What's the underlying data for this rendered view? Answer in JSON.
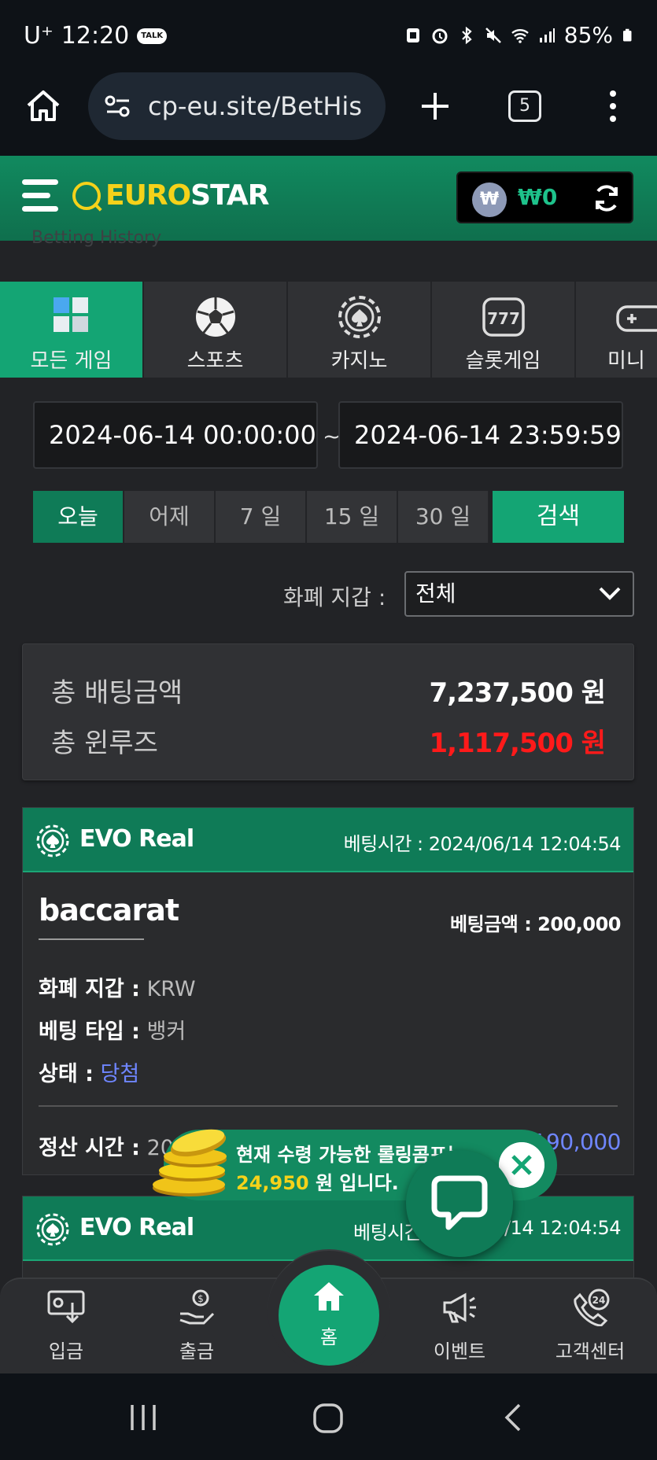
{
  "status_bar": {
    "carrier": "U⁺",
    "time": "12:20",
    "talk_badge": "TALK",
    "battery": "85%"
  },
  "browser": {
    "url": "cp-eu.site/BetHis",
    "tab_count": "5"
  },
  "header": {
    "logo_prefix": "EURO",
    "logo_suffix": "STAR",
    "wallet_symbol": "₩",
    "balance": "₩0"
  },
  "page": {
    "faint_title": "Betting History"
  },
  "categories": [
    {
      "label": "모든 게임",
      "icon": "cubes-icon"
    },
    {
      "label": "스포츠",
      "icon": "soccer-ball-icon"
    },
    {
      "label": "카지노",
      "icon": "casino-chip-icon"
    },
    {
      "label": "슬롯게임",
      "icon": "slot-machine-icon"
    },
    {
      "label": "미니",
      "icon": "gamepad-icon"
    }
  ],
  "filters": {
    "date_from": "2024-06-14 00:00:00",
    "date_to": "2024-06-14 23:59:59",
    "separator": "~",
    "quick_ranges": [
      "오늘",
      "어제",
      "7 일",
      "15 일",
      "30 일"
    ],
    "search_label": "검색",
    "currency_label": "화폐 지갑 :",
    "currency_value": "전체"
  },
  "summary": {
    "total_bet_label": "총 배팅금액",
    "total_bet_value": "7,237,500 원",
    "total_winloss_label": "총 윈루즈",
    "total_winloss_value": "1,117,500 원"
  },
  "bets": [
    {
      "provider": "EVO Real",
      "bet_time": "베팅시간 : 2024/06/14 12:04:54",
      "game": "baccarat",
      "bet_amount": "베팅금액 : 200,000",
      "currency_label": "화폐 지갑 :",
      "currency": "KRW",
      "bet_type_label": "베팅 타입 :",
      "bet_type": "뱅커",
      "status_label": "상태 :",
      "status": "당첨",
      "settle_label": "정산 시간 :",
      "settle_time_partial": "202",
      "payout_partial": "190,000"
    },
    {
      "provider": "EVO Real",
      "bet_time_partial_left": "베팅시간",
      "bet_time_partial_right": "6/14 12:04:54"
    }
  ],
  "toast": {
    "line1": "현재 수령 가능한 롤링콤프는",
    "amount": "24,950",
    "line2_suffix": "원 입니다."
  },
  "bottom_nav": [
    {
      "label": "입금",
      "icon": "deposit-icon"
    },
    {
      "label": "출금",
      "icon": "withdraw-icon"
    },
    {
      "label": "홈",
      "icon": "home-icon"
    },
    {
      "label": "이벤트",
      "icon": "megaphone-icon"
    },
    {
      "label": "고객센터",
      "icon": "support-24-icon"
    }
  ],
  "colors": {
    "brand_green": "#14a574",
    "dark_green": "#0f7b57",
    "logo_yellow": "#f5d21a",
    "loss_red": "#ff1a1a",
    "win_blue": "#6f86ff"
  }
}
